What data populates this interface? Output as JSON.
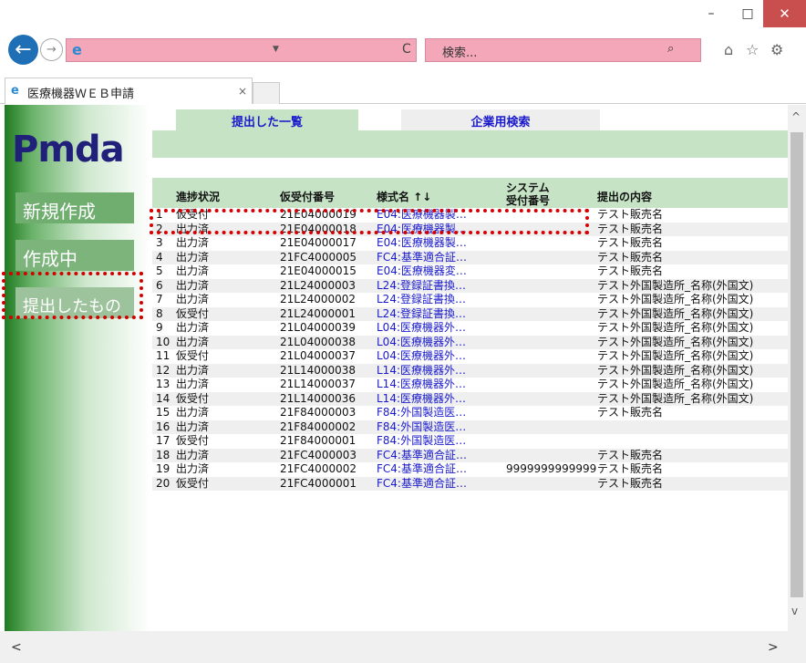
{
  "window": {
    "minimize": "–",
    "maximize": "□",
    "close": "✕"
  },
  "nav": {
    "back": "←",
    "forward": "→",
    "refresh": "C",
    "search_placeholder": "検索...",
    "search_icon": "⌕",
    "home_icon": "⌂",
    "star_icon": "☆",
    "gear_icon": "⚙"
  },
  "browser_tab": {
    "title": "医療機器ＷＥＢ申請",
    "close": "×"
  },
  "logo": "Pmda",
  "sidebar": {
    "new": "新規作成",
    "in_progress": "作成中",
    "submitted": "提出したもの"
  },
  "content_tabs": {
    "submitted_list": "提出した一覧",
    "corp_search": "企業用検索"
  },
  "table": {
    "headers": {
      "status": "進捗状況",
      "receipt": "仮受付番号",
      "form": "様式名 ↑↓",
      "system_line1": "システム",
      "system_line2": "受付番号",
      "content": "提出の内容"
    },
    "rows": [
      {
        "n": "1",
        "status": "仮受付",
        "receipt": "21E04000019",
        "form": "E04:医療機器製…",
        "sys": "",
        "content": "テスト販売名"
      },
      {
        "n": "2",
        "status": "出力済",
        "receipt": "21E04000018",
        "form": "E04:医療機器製…",
        "sys": "",
        "content": "テスト販売名"
      },
      {
        "n": "3",
        "status": "出力済",
        "receipt": "21E04000017",
        "form": "E04:医療機器製…",
        "sys": "",
        "content": "テスト販売名"
      },
      {
        "n": "4",
        "status": "出力済",
        "receipt": "21FC4000005",
        "form": "FC4:基準適合証…",
        "sys": "",
        "content": "テスト販売名"
      },
      {
        "n": "5",
        "status": "出力済",
        "receipt": "21E04000015",
        "form": "E04:医療機器変…",
        "sys": "",
        "content": "テスト販売名"
      },
      {
        "n": "6",
        "status": "出力済",
        "receipt": "21L24000003",
        "form": "L24:登録証書換…",
        "sys": "",
        "content": "テスト外国製造所_名称(外国文)"
      },
      {
        "n": "7",
        "status": "出力済",
        "receipt": "21L24000002",
        "form": "L24:登録証書換…",
        "sys": "",
        "content": "テスト外国製造所_名称(外国文)"
      },
      {
        "n": "8",
        "status": "仮受付",
        "receipt": "21L24000001",
        "form": "L24:登録証書換…",
        "sys": "",
        "content": "テスト外国製造所_名称(外国文)"
      },
      {
        "n": "9",
        "status": "出力済",
        "receipt": "21L04000039",
        "form": "L04:医療機器外…",
        "sys": "",
        "content": "テスト外国製造所_名称(外国文)"
      },
      {
        "n": "10",
        "status": "出力済",
        "receipt": "21L04000038",
        "form": "L04:医療機器外…",
        "sys": "",
        "content": "テスト外国製造所_名称(外国文)"
      },
      {
        "n": "11",
        "status": "仮受付",
        "receipt": "21L04000037",
        "form": "L04:医療機器外…",
        "sys": "",
        "content": "テスト外国製造所_名称(外国文)"
      },
      {
        "n": "12",
        "status": "出力済",
        "receipt": "21L14000038",
        "form": "L14:医療機器外…",
        "sys": "",
        "content": "テスト外国製造所_名称(外国文)"
      },
      {
        "n": "13",
        "status": "出力済",
        "receipt": "21L14000037",
        "form": "L14:医療機器外…",
        "sys": "",
        "content": "テスト外国製造所_名称(外国文)"
      },
      {
        "n": "14",
        "status": "仮受付",
        "receipt": "21L14000036",
        "form": "L14:医療機器外…",
        "sys": "",
        "content": "テスト外国製造所_名称(外国文)"
      },
      {
        "n": "15",
        "status": "出力済",
        "receipt": "21F84000003",
        "form": "F84:外国製造医…",
        "sys": "",
        "content": "テスト販売名"
      },
      {
        "n": "16",
        "status": "出力済",
        "receipt": "21F84000002",
        "form": "F84:外国製造医…",
        "sys": "",
        "content": ""
      },
      {
        "n": "17",
        "status": "仮受付",
        "receipt": "21F84000001",
        "form": "F84:外国製造医…",
        "sys": "",
        "content": ""
      },
      {
        "n": "18",
        "status": "出力済",
        "receipt": "21FC4000003",
        "form": "FC4:基準適合証…",
        "sys": "",
        "content": "テスト販売名"
      },
      {
        "n": "19",
        "status": "出力済",
        "receipt": "21FC4000002",
        "form": "FC4:基準適合証…",
        "sys": "9999999999999",
        "content": "テスト販売名"
      },
      {
        "n": "20",
        "status": "仮受付",
        "receipt": "21FC4000001",
        "form": "FC4:基準適合証…",
        "sys": "",
        "content": "テスト販売名"
      }
    ]
  },
  "scroll": {
    "up": "^",
    "down": "v",
    "left": "<",
    "right": ">"
  }
}
